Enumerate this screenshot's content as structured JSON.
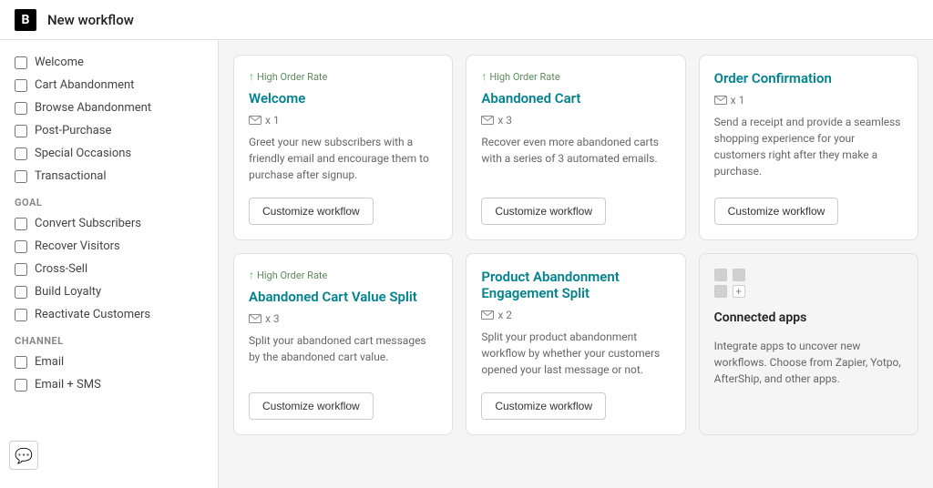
{
  "header": {
    "title": "New workflow",
    "logo_char": "B"
  },
  "sidebar": {
    "categories": [
      {
        "label": "Welcome",
        "checked": false
      },
      {
        "label": "Cart Abandonment",
        "checked": false
      },
      {
        "label": "Browse Abandonment",
        "checked": false
      },
      {
        "label": "Post-Purchase",
        "checked": false
      },
      {
        "label": "Special Occasions",
        "checked": false
      },
      {
        "label": "Transactional",
        "checked": false
      }
    ],
    "goal_label": "GOAL",
    "goals": [
      {
        "label": "Convert Subscribers",
        "checked": false
      },
      {
        "label": "Recover Visitors",
        "checked": false
      },
      {
        "label": "Cross-Sell",
        "checked": false
      },
      {
        "label": "Build Loyalty",
        "checked": false
      },
      {
        "label": "Reactivate Customers",
        "checked": false
      }
    ],
    "channel_label": "CHANNEL",
    "channels": [
      {
        "label": "Email",
        "checked": false
      },
      {
        "label": "Email + SMS",
        "checked": false
      }
    ]
  },
  "cards": [
    {
      "badge": "High Order Rate",
      "title": "Welcome",
      "meta": "x 1",
      "description": "Greet your new subscribers with a friendly email and encourage them to purchase after signup.",
      "btn": "Customize workflow",
      "has_badge": true
    },
    {
      "badge": "High Order Rate",
      "title": "Abandoned Cart",
      "meta": "x 3",
      "description": "Recover even more abandoned carts with a series of 3 automated emails.",
      "btn": "Customize workflow",
      "has_badge": true
    },
    {
      "badge": "",
      "title": "Order Confirmation",
      "meta": "x 1",
      "description": "Send a receipt and provide a seamless shopping experience for your customers right after they make a purchase.",
      "btn": "Customize workflow",
      "has_badge": false
    },
    {
      "badge": "High Order Rate",
      "title": "Abandoned Cart Value Split",
      "meta": "x 3",
      "description": "Split your abandoned cart messages by the abandoned cart value.",
      "btn": "Customize workflow",
      "has_badge": true
    },
    {
      "badge": "",
      "title": "Product Abandonment Engagement Split",
      "meta": "x 2",
      "description": "Split your product abandonment workflow by whether your customers opened your last message or not.",
      "btn": "Customize workflow",
      "has_badge": false
    }
  ],
  "connected_apps": {
    "title": "Connected apps",
    "description": "Integrate apps to uncover new workflows. Choose from Zapier, Yotpo, AfterShip, and other apps."
  },
  "bottom_nav": {
    "icon": "💬"
  }
}
